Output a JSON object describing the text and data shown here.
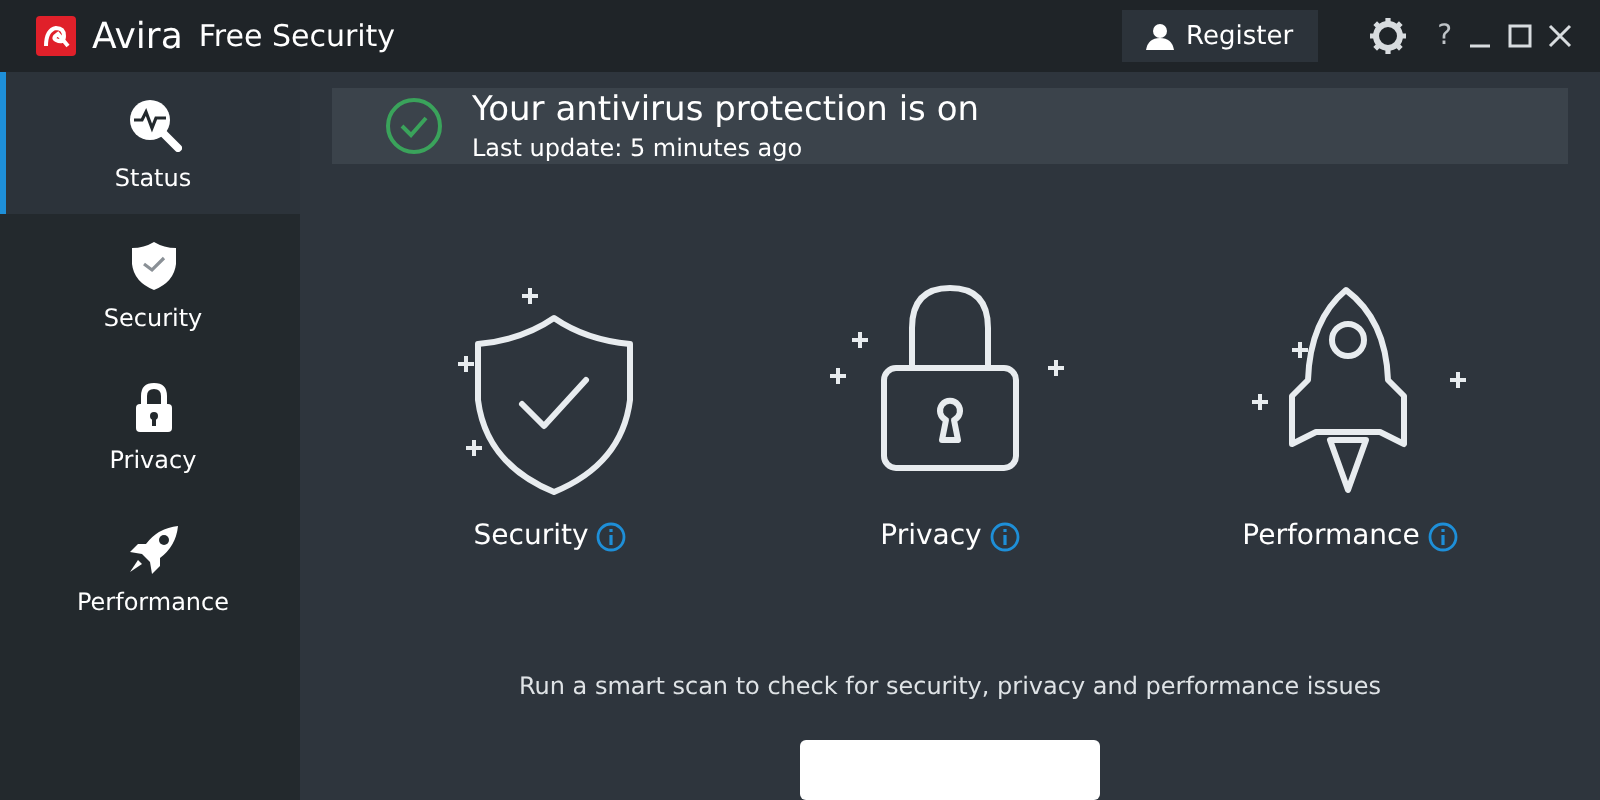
{
  "window": {
    "app_name": "Avira",
    "title": "Free Security"
  },
  "titlebar": {
    "register_button": "Register",
    "help": "?"
  },
  "sidebar": {
    "items": [
      {
        "label": "Status",
        "kind": "status",
        "selected": true
      },
      {
        "label": "Security",
        "kind": "security",
        "selected": false
      },
      {
        "label": "Privacy",
        "kind": "privacy",
        "selected": false
      },
      {
        "label": "Performance",
        "kind": "performance",
        "selected": false
      }
    ]
  },
  "status_banner": {
    "title": "Your antivirus protection is on",
    "subtitle": "Last update: 5 minutes ago"
  },
  "features": [
    {
      "label": "Security",
      "kind": "security"
    },
    {
      "label": "Privacy",
      "kind": "privacy"
    },
    {
      "label": "Performance",
      "kind": "performance"
    }
  ],
  "scan_hint": "Run a smart scan to check for security, privacy and performance issues"
}
